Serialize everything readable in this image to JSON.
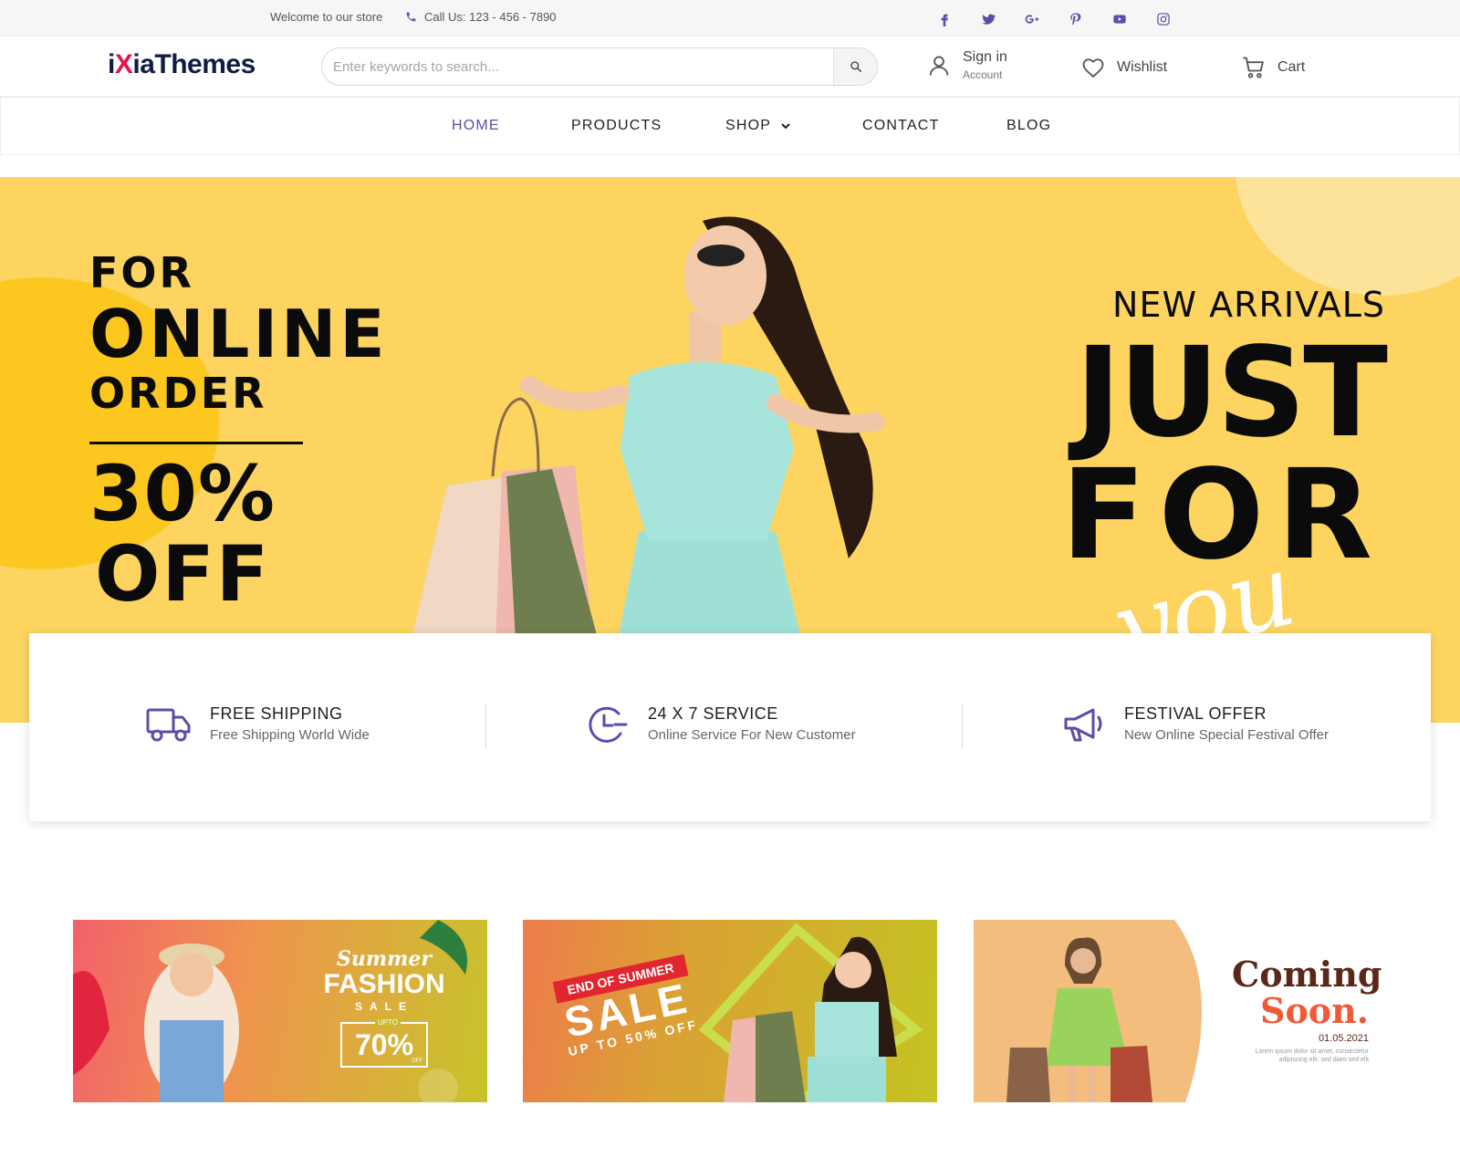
{
  "topbar": {
    "welcome": "Welcome to our store",
    "phone": "Call Us: 123 - 456 - 7890",
    "socials": [
      "facebook-icon",
      "twitter-icon",
      "google-plus-icon",
      "pinterest-icon",
      "youtube-icon",
      "instagram-icon"
    ]
  },
  "header": {
    "logo_prefix": "i",
    "logo_x": "X",
    "logo_suffix": "iaThemes",
    "search_placeholder": "Enter keywords to search...",
    "signin_label": "Sign in",
    "signin_sub": "Account",
    "wishlist_label": "Wishlist",
    "cart_label": "Cart"
  },
  "nav": {
    "items": [
      {
        "label": "HOME",
        "active": true
      },
      {
        "label": "PRODUCTS"
      },
      {
        "label": "SHOP",
        "dropdown": true
      },
      {
        "label": "CONTACT"
      },
      {
        "label": "BLOG"
      }
    ]
  },
  "hero": {
    "line1": "FOR",
    "line2": "ONLINE",
    "line3": "ORDER",
    "line4": "30%",
    "line5": "OFF",
    "right_kicker": "NEW ARRIVALS",
    "right_big1": "JUST",
    "right_big2": "FOR",
    "right_script": "you"
  },
  "features": [
    {
      "title": "FREE SHIPPING",
      "subtitle": "Free Shipping World Wide",
      "icon": "truck-icon"
    },
    {
      "title": "24 X 7 SERVICE",
      "subtitle": "Online Service For New Customer",
      "icon": "clock-icon"
    },
    {
      "title": "FESTIVAL OFFER",
      "subtitle": "New Online Special Festival Offer",
      "icon": "megaphone-icon"
    }
  ],
  "banners": {
    "b1": {
      "script": "Summer",
      "title": "FASHION",
      "sub": "SALE",
      "upto": "UPTO",
      "pct": "70%",
      "off": "OFF"
    },
    "b2": {
      "ribbon": "END OF SUMMER",
      "title": "SALE",
      "sub": "UP TO 50% OFF"
    },
    "b3": {
      "title1": "Coming",
      "title2": "Soon.",
      "date": "01.05.2021",
      "lorem": "Lorem ipsum dolor sit amet, consectetur adipiscing elit, sed diam sed elit"
    }
  },
  "colors": {
    "accent": "#5a4fa6",
    "logo_x": "#e3144f",
    "hero_bg": "#fcd45f",
    "hero_circle": "#fcc81f"
  }
}
